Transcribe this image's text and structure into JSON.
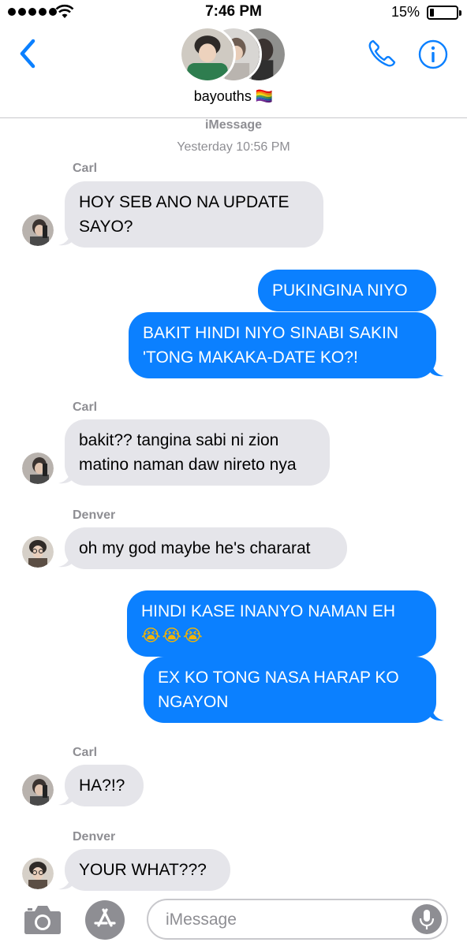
{
  "status_bar": {
    "time": "7:46 PM",
    "battery_text": "15%",
    "battery_level": 0.15,
    "signal_dots": 5
  },
  "header": {
    "group_name": "bayouths 🏳️‍🌈",
    "back_icon": "chevron-left-icon",
    "call_icon": "phone-icon",
    "info_icon": "info-icon"
  },
  "thread": {
    "service": "iMessage",
    "timestamp": "Yesterday 10:56 PM"
  },
  "messages": [
    {
      "sender": "Carl",
      "direction": "incoming",
      "text": "HOY SEB ANO NA UPDATE\nSAYO?"
    },
    {
      "direction": "outgoing",
      "text": "PUKINGINA NIYO"
    },
    {
      "direction": "outgoing",
      "text": "BAKIT HINDI NIYO SINABI SAKIN\n'TONG MAKAKA-DATE KO?!"
    },
    {
      "sender": "Carl",
      "direction": "incoming",
      "text": "bakit?? tangina sabi ni zion\nmatino naman daw nireto nya"
    },
    {
      "sender": "Denver",
      "direction": "incoming",
      "text": "oh my god maybe he's chararat"
    },
    {
      "direction": "outgoing",
      "text": "HINDI KASE INANYO NAMAN EH",
      "emoji": "😭😭😭"
    },
    {
      "direction": "outgoing",
      "text": "EX KO TONG NASA HARAP KO\nNGAYON"
    },
    {
      "sender": "Carl",
      "direction": "incoming",
      "text": "HA?!?"
    },
    {
      "sender": "Denver",
      "direction": "incoming",
      "text": "YOUR WHAT???"
    }
  ],
  "input_bar": {
    "placeholder": "iMessage",
    "camera_icon": "camera-icon",
    "apps_icon": "app-store-icon",
    "mic_icon": "microphone-icon"
  },
  "colors": {
    "accent": "#0b80ff",
    "incoming_bubble": "#e5e5ea",
    "meta_text": "#8e8e93"
  }
}
